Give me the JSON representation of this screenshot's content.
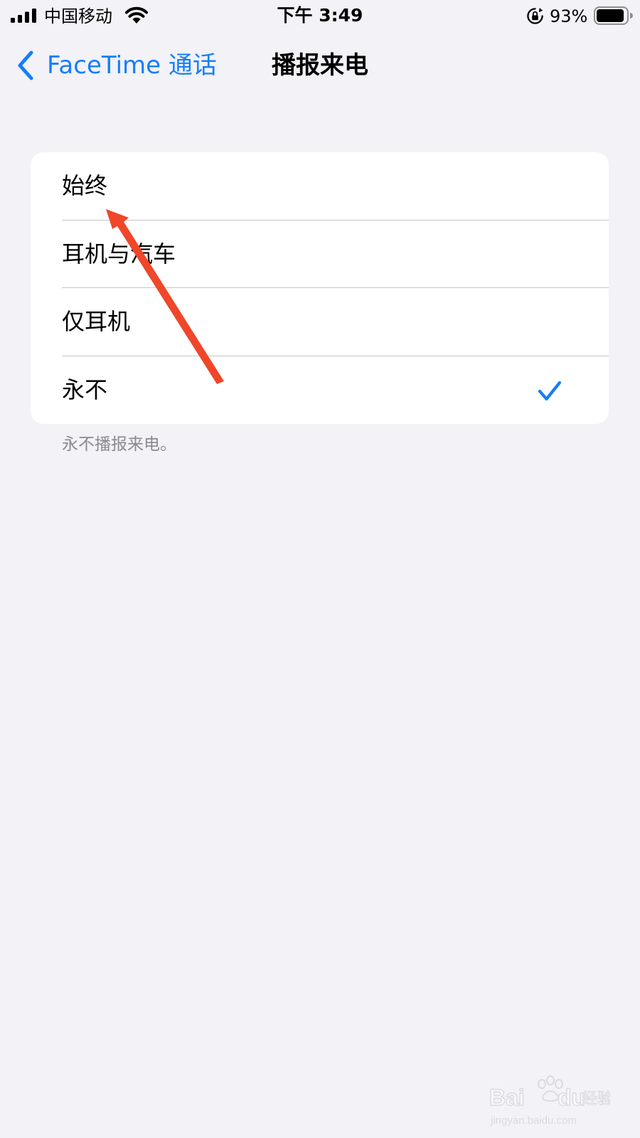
{
  "status_bar": {
    "carrier": "中国移动",
    "time": "下午 3:49",
    "battery_percent": "93%",
    "battery_level": 0.93,
    "icons": [
      "signal-icon",
      "wifi-icon",
      "rotation-lock-icon",
      "battery-icon"
    ]
  },
  "nav": {
    "back_label": "FaceTime 通话",
    "title": "播报来电"
  },
  "options": [
    {
      "label": "始终",
      "selected": false
    },
    {
      "label": "耳机与汽车",
      "selected": false
    },
    {
      "label": "仅耳机",
      "selected": false
    },
    {
      "label": "永不",
      "selected": true
    }
  ],
  "footer_note": "永不播报来电。",
  "watermark": {
    "logo": "Baidu经验",
    "url": "jingyan.baidu.com"
  },
  "colors": {
    "accent": "#147efb",
    "background": "#f2f2f7",
    "annotation": "#f0462a"
  }
}
